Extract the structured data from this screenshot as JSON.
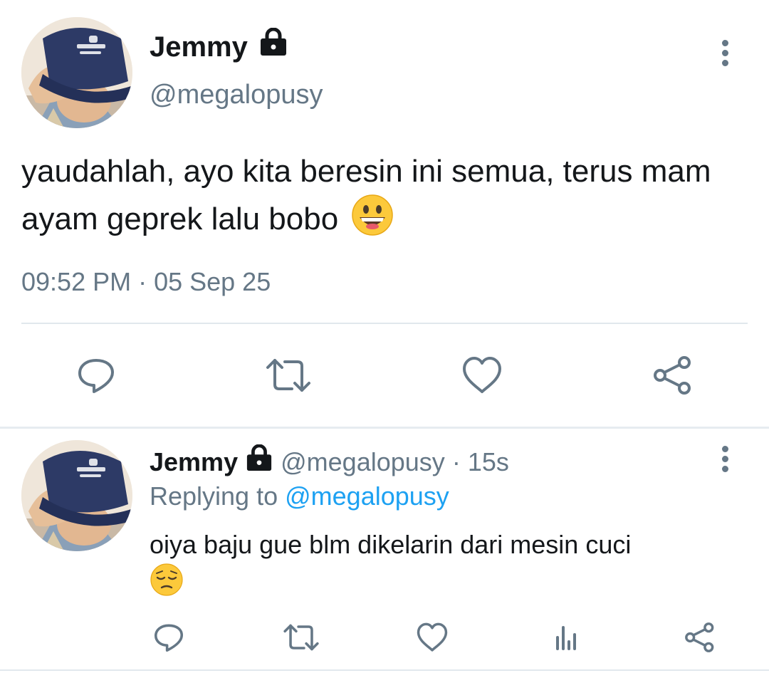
{
  "tweet": {
    "author_name": "Jemmy",
    "author_handle": "@megalopusy",
    "text": "yaudahlah, ayo kita beresin ini semua, terus mam ayam geprek lalu bobo",
    "emoji": "😀",
    "timestamp": "09:52 PM · 05 Sep 25",
    "icons": {
      "protected": "lock-icon",
      "more": "more-vertical-icon",
      "reply": "reply-icon",
      "retweet": "retweet-icon",
      "like": "heart-icon",
      "share": "share-icon"
    }
  },
  "reply": {
    "author_name": "Jemmy",
    "author_handle": "@megalopusy",
    "separator": "·",
    "age": "15s",
    "replying_label": "Replying to",
    "replying_handle": "@megalopusy",
    "text": "oiya baju gue blm dikelarin dari mesin cuci",
    "emoji": "😔",
    "icons": {
      "reply": "reply-icon",
      "retweet": "retweet-icon",
      "like": "heart-icon",
      "analytics": "analytics-icon",
      "share": "share-icon"
    }
  },
  "colors": {
    "text_primary": "#14171a",
    "text_secondary": "#657786",
    "link": "#1da1f2",
    "divider": "#e1e8ed"
  }
}
